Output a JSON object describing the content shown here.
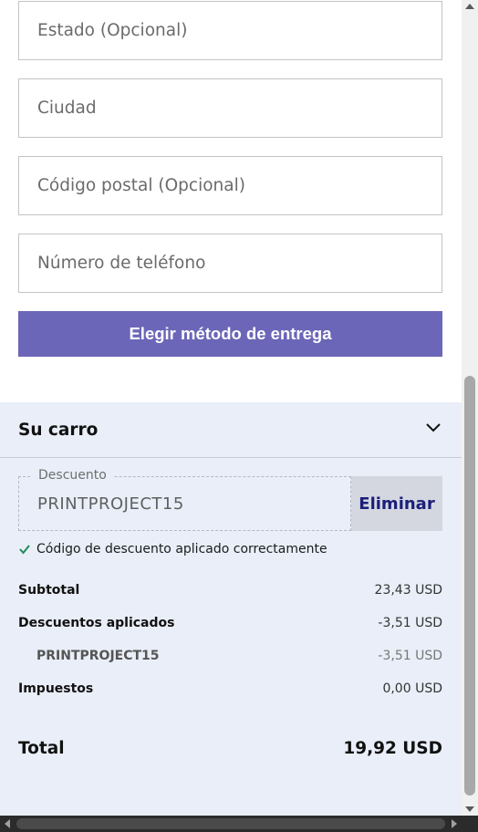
{
  "form": {
    "fields": [
      {
        "placeholder": "Estado (Opcional)"
      },
      {
        "placeholder": "Ciudad"
      },
      {
        "placeholder": "Código postal (Opcional)"
      },
      {
        "placeholder": "Número de teléfono"
      }
    ],
    "submit_label": "Elegir método de entrega",
    "accent_color": "#6b66b7"
  },
  "cart": {
    "title": "Su carro",
    "discount": {
      "legend": "Descuento",
      "code": "PRINTPROJECT15",
      "remove_label": "Eliminar",
      "success_message": "Código de descuento aplicado correctamente"
    },
    "summary": {
      "subtotal_label": "Subtotal",
      "subtotal_value": "23,43 USD",
      "discounts_label": "Descuentos aplicados",
      "discounts_value": "-3,51 USD",
      "discount_item_label": "PRINTPROJECT15",
      "discount_item_value": "-3,51 USD",
      "taxes_label": "Impuestos",
      "taxes_value": "0,00 USD",
      "total_label": "Total",
      "total_value": "19,92 USD"
    },
    "background_color": "#e9eef8"
  }
}
